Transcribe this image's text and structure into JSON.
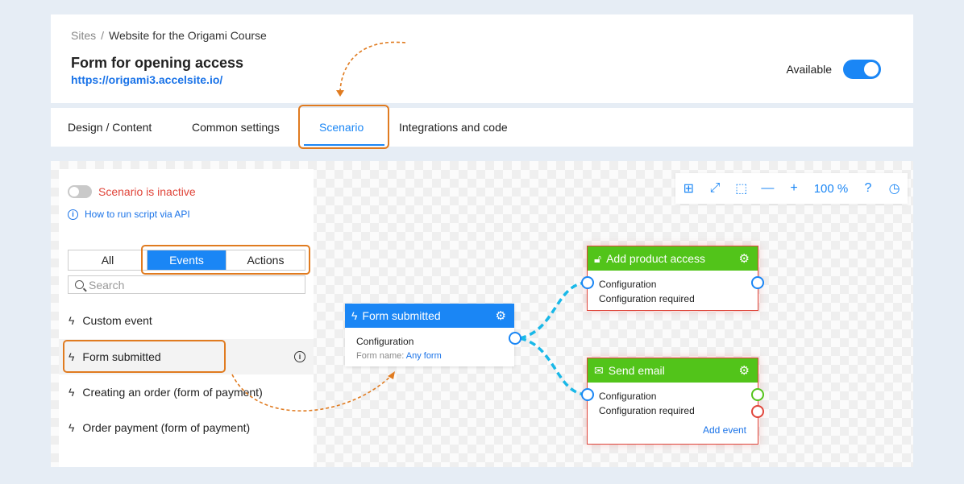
{
  "breadcrumb": {
    "root": "Sites",
    "separator": "/",
    "current": "Website for the Origami Course"
  },
  "page": {
    "title": "Form for opening access",
    "url": "https://origami3.accelsite.io/"
  },
  "availability": {
    "label": "Available",
    "enabled": true
  },
  "tabs": [
    {
      "label": "Design / Content",
      "active": false
    },
    {
      "label": "Common settings",
      "active": false
    },
    {
      "label": "Scenario",
      "active": true
    },
    {
      "label": "Integrations and code",
      "active": false
    }
  ],
  "panel": {
    "status_text": "Scenario is inactive",
    "api_link": "How to run script via API",
    "filters": [
      "All",
      "Events",
      "Actions"
    ],
    "active_filter": "Events",
    "search_placeholder": "Search",
    "events": [
      {
        "label": "Custom event"
      },
      {
        "label": "Form submitted",
        "selected": true
      },
      {
        "label": "Creating an order (form of payment)"
      },
      {
        "label": "Order payment (form of payment)"
      }
    ]
  },
  "toolbar": {
    "icons": [
      "grid-icon",
      "fit-screen-icon",
      "frame-icon",
      "zoom-out-icon",
      "zoom-in-icon",
      "help-icon",
      "history-icon"
    ],
    "zoom": "100 %"
  },
  "nodes": {
    "trigger": {
      "title": "Form submitted",
      "config": "Configuration",
      "form_label": "Form name:",
      "form_value": "Any form"
    },
    "action1": {
      "title": "Add product access",
      "config": "Configuration",
      "status": "Configuration required"
    },
    "action2": {
      "title": "Send email",
      "config": "Configuration",
      "status": "Configuration required",
      "add_event": "Add event"
    }
  },
  "colors": {
    "accent": "#1a86f5",
    "action": "#52c41a",
    "error": "#e0453a",
    "highlight": "#e07b20"
  }
}
